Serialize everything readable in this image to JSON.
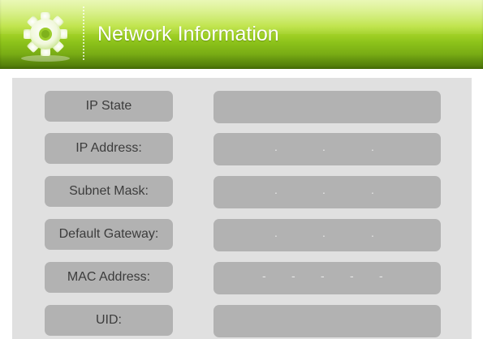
{
  "header": {
    "title": "Network Information",
    "icon": "gear-icon",
    "color": "#9acd32"
  },
  "fields": [
    {
      "label": "IP State",
      "value": ""
    },
    {
      "label": "IP Address:",
      "value": "",
      "separators": [
        ".",
        ".",
        "."
      ]
    },
    {
      "label": "Subnet Mask:",
      "value": "",
      "separators": [
        ".",
        ".",
        "."
      ]
    },
    {
      "label": "Default Gateway:",
      "value": "",
      "separators": [
        ".",
        ".",
        "."
      ]
    },
    {
      "label": "MAC Address:",
      "value": "",
      "separators": [
        "-",
        "-",
        "-",
        "-",
        "-"
      ]
    },
    {
      "label": "UID:",
      "value": ""
    }
  ]
}
